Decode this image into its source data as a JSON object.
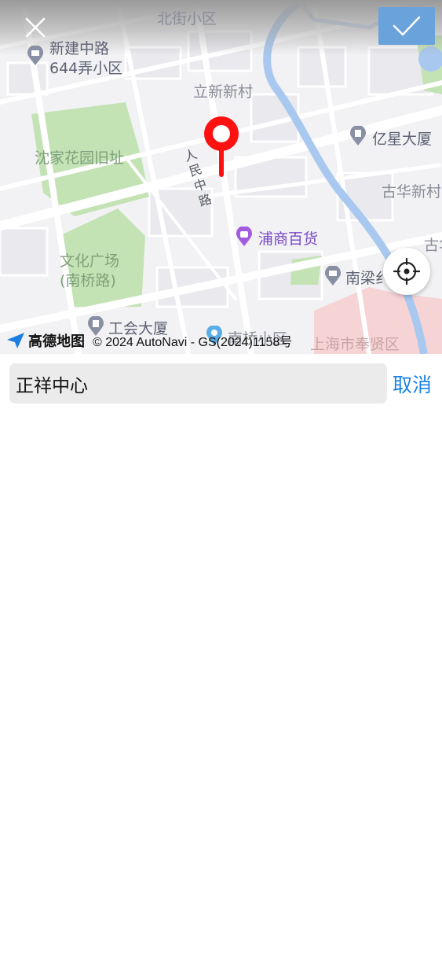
{
  "map": {
    "labels": {
      "beijie": "北街小区",
      "xinjian_1": "新建中路",
      "xinjian_2": "644弄小区",
      "lixin": "立新新村",
      "shenjia": "沈家花园旧址",
      "renmin": "人民中路",
      "yixing": "亿星大厦",
      "guhua": "古华新村",
      "gu2": "古华",
      "pushang": "浦商百货",
      "wenhua_1": "文化广场",
      "wenhua_2": "(南桥路)",
      "nanliang": "南梁纟",
      "gonghui": "工会大厦",
      "fengxian": "上海市奉贤区",
      "nanqiao_partial": "南桥小区"
    },
    "attribution": {
      "brand": "高德地图",
      "copyright": "© 2024 AutoNavi - GS(2024)1158号"
    },
    "colors": {
      "river": "#a9c8ef",
      "park": "#c4e3b5",
      "pin": "#ff1111",
      "confirm": "#6aa3dc",
      "cancel_text": "#1a82e6"
    },
    "icons": [
      "close-icon",
      "check-icon",
      "location-pin-icon",
      "locate-crosshair-icon",
      "amap-logo-icon",
      "building-poi-icon",
      "shopping-poi-icon"
    ]
  },
  "search": {
    "value": "正祥中心",
    "cancel_label": "取消"
  }
}
